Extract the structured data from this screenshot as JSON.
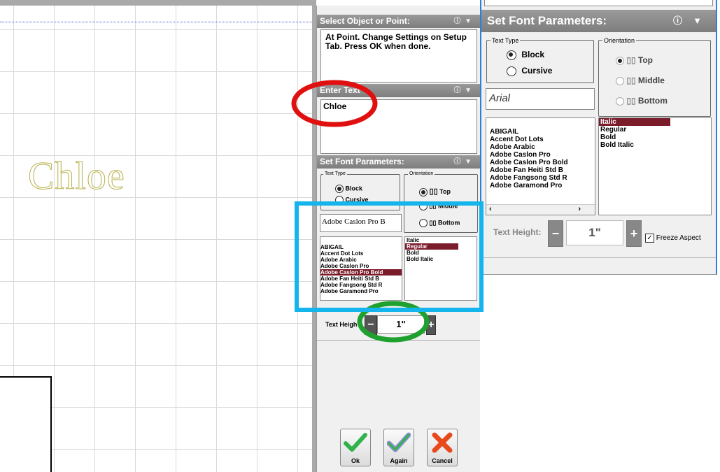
{
  "canvas": {
    "sample_text": "Chloe"
  },
  "middle_panel": {
    "select_header": "Select Object or Point:",
    "instruction": "At Point. Change Settings on Setup Tab. Press OK when done.",
    "enter_text_header": "Enter Text",
    "entered_text": "Chloe",
    "font_params_header": "Set Font Parameters:",
    "text_type_legend": "Text Type",
    "text_type_options": [
      "Block",
      "Cursive"
    ],
    "text_type_selected": "Block",
    "orientation_legend": "Orientation",
    "orientation_options": [
      "Top",
      "Middle",
      "Bottom"
    ],
    "orientation_selected": "Top",
    "font_preview": "Adobe Caslon Pro B",
    "font_list": [
      "ABIGAIL",
      "Accent Dot Lots",
      "Adobe Arabic",
      "Adobe Caslon Pro",
      "Adobe Caslon Pro Bold",
      "Adobe Fan Heiti Std B",
      "Adobe Fangsong Std R",
      "Adobe Garamond Pro"
    ],
    "font_selected": "Adobe Caslon Pro Bold",
    "style_list": [
      "Italic",
      "Regular",
      "Bold",
      "Bold Italic"
    ],
    "style_selected": "Regular",
    "text_height_label": "Text Heigh",
    "text_height_value": "1\"",
    "buttons": {
      "ok": "Ok",
      "again": "Again",
      "cancel": "Cancel"
    },
    "help_icon": "?"
  },
  "right_panel": {
    "header": "Set Font Parameters:",
    "text_type_legend": "Text Type",
    "text_type_options": [
      "Block",
      "Cursive"
    ],
    "text_type_selected": "Block",
    "orientation_legend": "Orientation",
    "orientation_options": [
      "Top",
      "Middle",
      "Bottom"
    ],
    "font_preview": "Arial",
    "font_list": [
      "ABIGAIL",
      "Accent Dot Lots",
      "Adobe Arabic",
      "Adobe Caslon Pro",
      "Adobe Caslon Pro Bold",
      "Adobe Fan Heiti Std B",
      "Adobe Fangsong Std R",
      "Adobe Garamond Pro"
    ],
    "style_list": [
      "Italic",
      "Regular",
      "Bold",
      "Bold Italic"
    ],
    "style_selected": "Italic",
    "text_height_label": "Text Height:",
    "text_height_value": "1\"",
    "freeze_aspect_label": "Freeze Aspect",
    "help_icon": "?"
  },
  "colors": {
    "selection": "#7b1c2b",
    "header_gray": "#8a8a8a",
    "annotation_red": "#e01010",
    "annotation_green": "#1fa12f",
    "annotation_blue": "#14b4ec"
  }
}
